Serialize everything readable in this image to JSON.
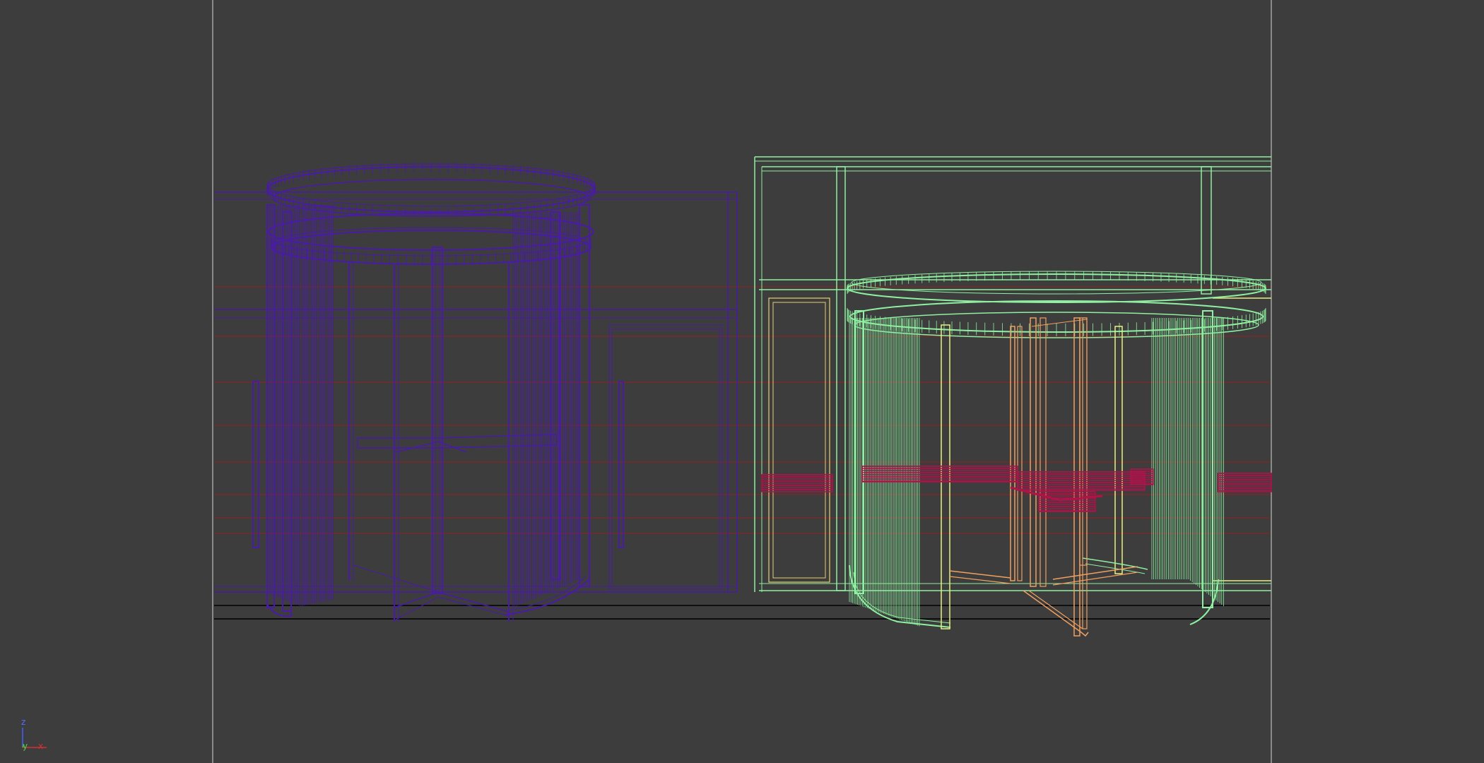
{
  "viewport": {
    "background": "#3d3d3d",
    "safe_frame_color": "#d8d8d8",
    "grid_line_color": "#b01818",
    "ground_line_color": "#000000"
  },
  "objects": [
    {
      "name": "revolving-door-left",
      "color": "#4a1aa8",
      "selected": false
    },
    {
      "name": "revolving-door-right",
      "color": "#8ef0a0",
      "selected": true
    },
    {
      "name": "door-wings-right",
      "color": "#f0a060"
    },
    {
      "name": "handrail-right",
      "color": "#b0124a"
    }
  ],
  "axis_gizmo": {
    "z_label": "z",
    "y_label": "y",
    "x_label": "x",
    "x_color": "#d43030",
    "y_color": "#40c040",
    "z_color": "#4060ff"
  }
}
